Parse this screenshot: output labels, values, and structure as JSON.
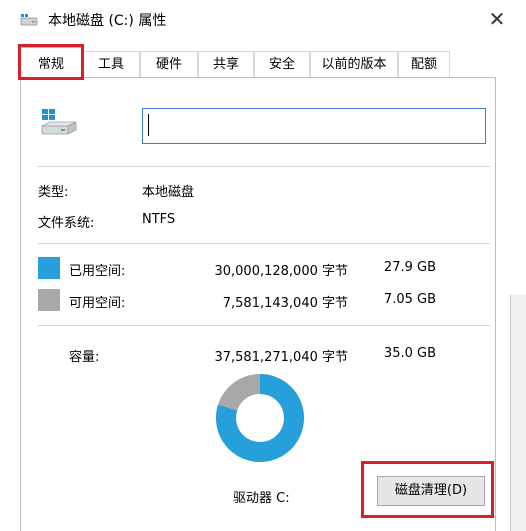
{
  "window": {
    "title": "本地磁盘 (C:) 属性",
    "close_glyph": "✕"
  },
  "tabs": [
    {
      "label": "常规",
      "active": true
    },
    {
      "label": "工具"
    },
    {
      "label": "硬件"
    },
    {
      "label": "共享"
    },
    {
      "label": "安全"
    },
    {
      "label": "以前的版本"
    },
    {
      "label": "配额"
    }
  ],
  "general": {
    "name_value": "",
    "type_label": "类型:",
    "type_value": "本地磁盘",
    "fs_label": "文件系统:",
    "fs_value": "NTFS",
    "used_label": "已用空间:",
    "used_bytes": "30,000,128,000 字节",
    "used_size": "27.9 GB",
    "free_label": "可用空间:",
    "free_bytes": "7,581,143,040 字节",
    "free_size": "7.05 GB",
    "capacity_label": "容量:",
    "capacity_bytes": "37,581,271,040 字节",
    "capacity_size": "35.0 GB",
    "drive_label": "驱动器 C:",
    "cleanup_button": "磁盘清理(D)"
  },
  "usage": {
    "used_fraction": 0.798,
    "used_color": "#26a0da",
    "free_color": "#a8a8a8"
  },
  "icons": {
    "title": "drive-icon",
    "drive": "windows-drive-icon",
    "close": "close-icon"
  }
}
